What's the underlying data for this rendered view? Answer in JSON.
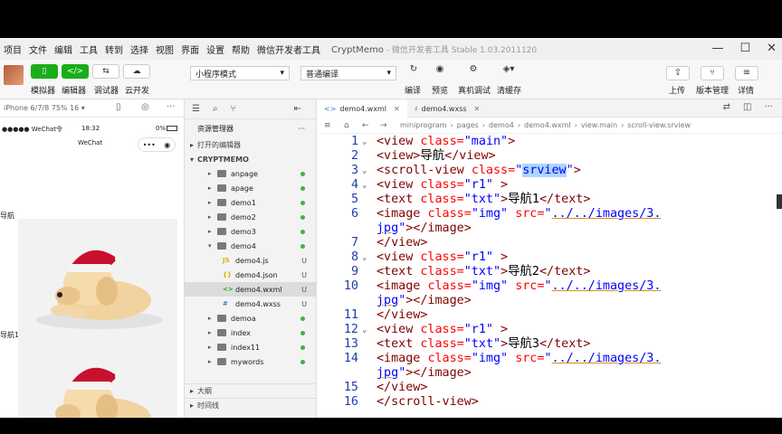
{
  "menubar": {
    "items": [
      "项目",
      "文件",
      "编辑",
      "工具",
      "转到",
      "选择",
      "视图",
      "界面",
      "设置",
      "帮助",
      "微信开发者工具"
    ],
    "app_name": "CryptMemo",
    "subtitle": "- 微信开发者工具 Stable 1.03.2011120"
  },
  "toolbar": {
    "left_buttons": [
      "模拟器",
      "编辑器",
      "调试器",
      "云开发"
    ],
    "mode_select": "小程序模式",
    "compile_select": "普通编译",
    "center_actions": [
      "编译",
      "预览",
      "真机调试",
      "清缓存"
    ],
    "right_actions": [
      "上传",
      "版本管理",
      "详情"
    ]
  },
  "simulator": {
    "device": "iPhone 6/7/8 75% 16 ▾",
    "status_left": "●●●●● WeChat令",
    "status_time": "18:32",
    "status_right": "0%",
    "nav_title": "WeChat",
    "capsule_more": "•••",
    "nav_labels": [
      "导航",
      "导航1"
    ]
  },
  "explorer": {
    "title": "资源管理器",
    "more": "···",
    "open_editors": "打开的编辑器",
    "project": "CRYPTMEMO",
    "items": [
      {
        "name": "anpage",
        "type": "folder",
        "depth": 1,
        "expanded": false,
        "status": "dot"
      },
      {
        "name": "apage",
        "type": "folder",
        "depth": 1,
        "expanded": false,
        "status": "dot"
      },
      {
        "name": "demo1",
        "type": "folder",
        "depth": 1,
        "expanded": false,
        "status": "dot"
      },
      {
        "name": "demo2",
        "type": "folder",
        "depth": 1,
        "expanded": false,
        "status": "dot"
      },
      {
        "name": "demo3",
        "type": "folder",
        "depth": 1,
        "expanded": false,
        "status": "dot"
      },
      {
        "name": "demo4",
        "type": "folder",
        "depth": 1,
        "expanded": true,
        "status": "dot"
      },
      {
        "name": "demo4.js",
        "type": "js",
        "depth": 2,
        "status": "U"
      },
      {
        "name": "demo4.json",
        "type": "json",
        "depth": 2,
        "status": "U"
      },
      {
        "name": "demo4.wxml",
        "type": "wxml",
        "depth": 2,
        "status": "U",
        "selected": true
      },
      {
        "name": "demo4.wxss",
        "type": "wxss",
        "depth": 2,
        "status": "U"
      },
      {
        "name": "demoa",
        "type": "folder",
        "depth": 1,
        "expanded": false,
        "status": "dot"
      },
      {
        "name": "index",
        "type": "folder",
        "depth": 1,
        "expanded": false,
        "status": "dot"
      },
      {
        "name": "index11",
        "type": "folder",
        "depth": 1,
        "expanded": false,
        "status": "dot"
      },
      {
        "name": "mywords",
        "type": "folder",
        "depth": 1,
        "expanded": false,
        "status": "dot"
      }
    ],
    "bottom_sections": [
      "大纲",
      "时间线"
    ]
  },
  "editor": {
    "tabs": [
      {
        "label": "demo4.wxml",
        "icon": "<>",
        "active": true
      },
      {
        "label": "demo4.wxss",
        "icon": "♯",
        "active": false
      }
    ],
    "breadcrumb": [
      "miniprogram",
      "pages",
      "demo4",
      "demo4.wxml",
      "view.main",
      "scroll-view.srview"
    ],
    "lines": [
      {
        "n": "1",
        "fold": "⌄",
        "segs": [
          [
            "tag",
            "<view "
          ],
          [
            "attr",
            "class="
          ],
          [
            "str",
            "\"main\""
          ],
          [
            "tag",
            ">"
          ]
        ]
      },
      {
        "n": "2",
        "fold": "",
        "segs": [
          [
            "tag",
            "<view>"
          ],
          [
            "txt",
            "导航"
          ],
          [
            "tag",
            "</view>"
          ]
        ]
      },
      {
        "n": "3",
        "fold": "⌄",
        "segs": [
          [
            "tag",
            "<scroll-view "
          ],
          [
            "attr",
            "class="
          ],
          [
            "str",
            "\""
          ],
          [
            "sel",
            "srview"
          ],
          [
            "str",
            "\""
          ],
          [
            "tag",
            ">"
          ]
        ]
      },
      {
        "n": "4",
        "fold": "⌄",
        "segs": [
          [
            "tag",
            "<view "
          ],
          [
            "attr",
            "class="
          ],
          [
            "str",
            "\"r1\""
          ],
          [
            "tag",
            " >"
          ]
        ]
      },
      {
        "n": "5",
        "fold": "",
        "segs": [
          [
            "tag",
            "<text "
          ],
          [
            "attr",
            "class="
          ],
          [
            "str",
            "\"txt\""
          ],
          [
            "tag",
            ">"
          ],
          [
            "txt",
            "导航1"
          ],
          [
            "tag",
            "</text>"
          ]
        ]
      },
      {
        "n": "6",
        "fold": "",
        "segs": [
          [
            "tag",
            "<image "
          ],
          [
            "attr",
            "class="
          ],
          [
            "str",
            "\"img\" "
          ],
          [
            "attr",
            "src="
          ],
          [
            "str",
            "\""
          ],
          [
            "path",
            "../../images/3."
          ]
        ]
      },
      {
        "n": "",
        "fold": "",
        "segs": [
          [
            "path",
            "jpg"
          ],
          [
            "str",
            "\""
          ],
          [
            "tag",
            "></image>"
          ]
        ]
      },
      {
        "n": "7",
        "fold": "",
        "segs": [
          [
            "tag",
            "</view>"
          ]
        ]
      },
      {
        "n": "8",
        "fold": "⌄",
        "segs": [
          [
            "tag",
            "<view "
          ],
          [
            "attr",
            "class="
          ],
          [
            "str",
            "\"r1\""
          ],
          [
            "tag",
            " >"
          ]
        ]
      },
      {
        "n": "9",
        "fold": "",
        "segs": [
          [
            "tag",
            "<text "
          ],
          [
            "attr",
            "class="
          ],
          [
            "str",
            "\"txt\""
          ],
          [
            "tag",
            ">"
          ],
          [
            "txt",
            "导航2"
          ],
          [
            "tag",
            "</text>"
          ]
        ]
      },
      {
        "n": "10",
        "fold": "",
        "segs": [
          [
            "tag",
            "<image "
          ],
          [
            "attr",
            "class="
          ],
          [
            "str",
            "\"img\" "
          ],
          [
            "attr",
            "src="
          ],
          [
            "str",
            "\""
          ],
          [
            "path",
            "../../images/3."
          ]
        ]
      },
      {
        "n": "",
        "fold": "",
        "segs": [
          [
            "path",
            "jpg"
          ],
          [
            "str",
            "\""
          ],
          [
            "tag",
            "></image>"
          ]
        ]
      },
      {
        "n": "11",
        "fold": "",
        "segs": [
          [
            "tag",
            "</view>"
          ]
        ]
      },
      {
        "n": "12",
        "fold": "⌄",
        "segs": [
          [
            "tag",
            "<view "
          ],
          [
            "attr",
            "class="
          ],
          [
            "str",
            "\"r1\""
          ],
          [
            "tag",
            " >"
          ]
        ]
      },
      {
        "n": "13",
        "fold": "",
        "segs": [
          [
            "tag",
            "<text "
          ],
          [
            "attr",
            "class="
          ],
          [
            "str",
            "\"txt\""
          ],
          [
            "tag",
            ">"
          ],
          [
            "txt",
            "导航3"
          ],
          [
            "tag",
            "</text>"
          ]
        ]
      },
      {
        "n": "14",
        "fold": "",
        "segs": [
          [
            "tag",
            "<image "
          ],
          [
            "attr",
            "class="
          ],
          [
            "str",
            "\"img\" "
          ],
          [
            "attr",
            "src="
          ],
          [
            "str",
            "\""
          ],
          [
            "path",
            "../../images/3."
          ]
        ]
      },
      {
        "n": "",
        "fold": "",
        "segs": [
          [
            "path",
            "jpg"
          ],
          [
            "str",
            "\""
          ],
          [
            "tag",
            "></image>"
          ]
        ]
      },
      {
        "n": "15",
        "fold": "",
        "segs": [
          [
            "tag",
            "</view>"
          ]
        ]
      },
      {
        "n": "16",
        "fold": "",
        "segs": [
          [
            "tag",
            "</scroll-view>"
          ]
        ]
      }
    ]
  },
  "colors": {
    "accent_green": "#1aad19",
    "tag": "#800000",
    "attr": "#ff0000",
    "string": "#0000ff",
    "line_number": "#1f3fa8"
  }
}
